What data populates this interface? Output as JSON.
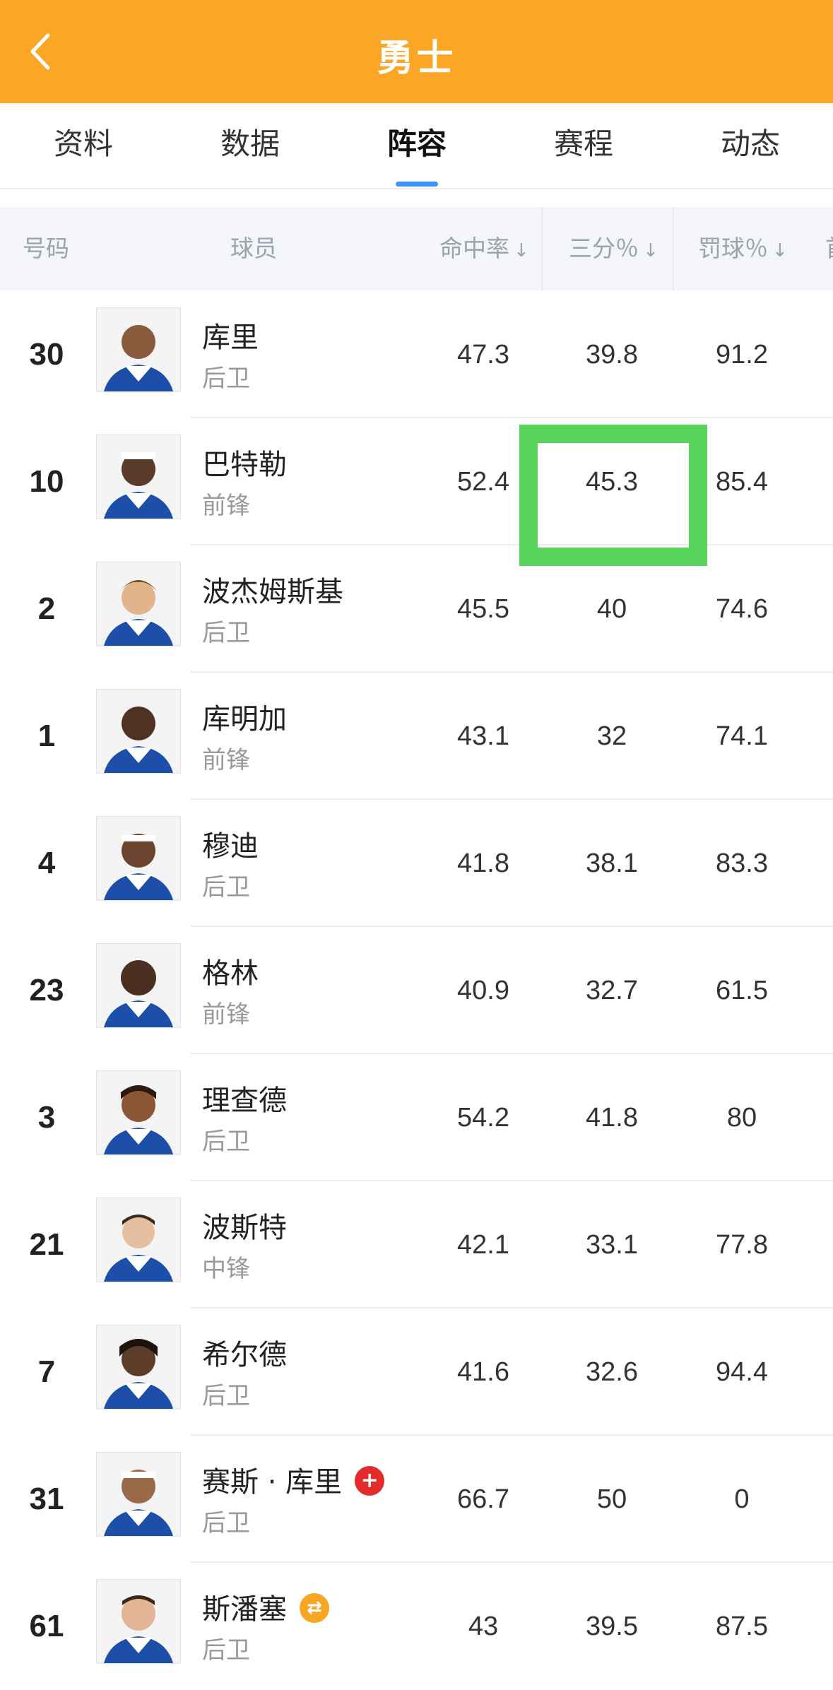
{
  "header": {
    "title": "勇士"
  },
  "tabs": [
    {
      "label": "资料"
    },
    {
      "label": "数据"
    },
    {
      "label": "阵容",
      "active": true
    },
    {
      "label": "赛程"
    },
    {
      "label": "动态"
    }
  ],
  "table": {
    "columns": {
      "number": "号码",
      "player": "球员",
      "fg_pct": "命中率",
      "three_pct": "三分％",
      "ft_pct": "罚球％",
      "more": "首"
    },
    "sort_arrow": "↓",
    "rows": [
      {
        "number": "30",
        "name": "库里",
        "position": "后卫",
        "fg": "47.3",
        "three": "39.8",
        "ft": "91.2"
      },
      {
        "number": "10",
        "name": "巴特勒",
        "position": "前锋",
        "fg": "52.4",
        "three": "45.3",
        "ft": "85.4"
      },
      {
        "number": "2",
        "name": "波杰姆斯基",
        "position": "后卫",
        "fg": "45.5",
        "three": "40",
        "ft": "74.6"
      },
      {
        "number": "1",
        "name": "库明加",
        "position": "前锋",
        "fg": "43.1",
        "three": "32",
        "ft": "74.1"
      },
      {
        "number": "4",
        "name": "穆迪",
        "position": "后卫",
        "fg": "41.8",
        "three": "38.1",
        "ft": "83.3"
      },
      {
        "number": "23",
        "name": "格林",
        "position": "前锋",
        "fg": "40.9",
        "three": "32.7",
        "ft": "61.5"
      },
      {
        "number": "3",
        "name": "理查德",
        "position": "后卫",
        "fg": "54.2",
        "three": "41.8",
        "ft": "80"
      },
      {
        "number": "21",
        "name": "波斯特",
        "position": "中锋",
        "fg": "42.1",
        "three": "33.1",
        "ft": "77.8"
      },
      {
        "number": "7",
        "name": "希尔德",
        "position": "后卫",
        "fg": "41.6",
        "three": "32.6",
        "ft": "94.4"
      },
      {
        "number": "31",
        "name": "赛斯 · 库里",
        "position": "后卫",
        "fg": "66.7",
        "three": "50",
        "ft": "0",
        "badge": "injury-cross-icon"
      },
      {
        "number": "61",
        "name": "斯潘塞",
        "position": "后卫",
        "fg": "43",
        "three": "39.5",
        "ft": "87.5",
        "badge": "two-way-contract-icon"
      }
    ]
  },
  "colors": {
    "header_bg": "#FBA624",
    "tab_indicator": "#3d93ff",
    "highlight": "#56d55a",
    "injury_badge": "#e42b2b",
    "contract_badge": "#f6a623"
  }
}
